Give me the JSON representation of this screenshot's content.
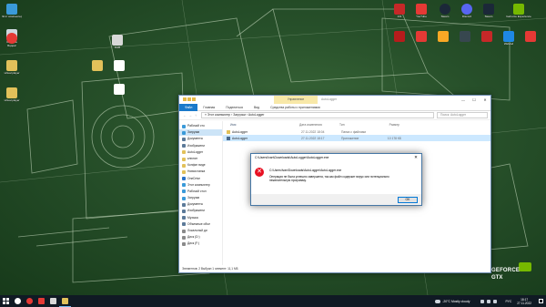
{
  "desktop": {
    "left_icons": [
      {
        "label": "Этот компьютер",
        "color": "#3a9ad9"
      },
      {
        "label": "Корзина",
        "color": "#cfd8e0"
      },
      {
        "label": "Яндекс",
        "color": "#e53935"
      },
      {
        "label": "virtual player",
        "color": "#e2c15a"
      },
      {
        "label": "virtual player",
        "color": "#e2c15a"
      }
    ],
    "mid_icons": [
      {
        "label": "DAB",
        "color": "#d8d8d8"
      },
      {
        "label": "",
        "color": "#e2c15a"
      },
      {
        "label": "",
        "color": "#ffffff"
      },
      {
        "label": "",
        "color": "#ffffff"
      }
    ],
    "top_icons_row1": [
      {
        "label": "131",
        "color": "#c62828"
      },
      {
        "label": "YouTube",
        "color": "#e53935"
      },
      {
        "label": "Steam",
        "color": "#1b2838"
      },
      {
        "label": "Discord",
        "color": "#5865f2"
      },
      {
        "label": "Steam",
        "color": "#1b2838"
      },
      {
        "label": "GeForce Experience",
        "color": "#76b900"
      }
    ],
    "top_icons_row2": [
      {
        "label": "",
        "color": "#b71c1c"
      },
      {
        "label": "",
        "color": "#e53935"
      },
      {
        "label": "",
        "color": "#f9a825"
      },
      {
        "label": "",
        "color": "#37474f"
      },
      {
        "label": "",
        "color": "#c62828"
      },
      {
        "label": "WeMod",
        "color": "#1e88e5"
      },
      {
        "label": "",
        "color": "#e53935"
      }
    ],
    "brand": {
      "line1": "GEFORCE",
      "line2": "GTX",
      "color": "#76b900"
    }
  },
  "explorer": {
    "ribbon_context": "Управление",
    "title": "AutoLogger",
    "tabs": [
      "Файл",
      "Главная",
      "Поделиться",
      "Вид",
      "Средства работы с приложениями"
    ],
    "breadcrumb": "« Этот компьютер › Загрузки › AutoLogger",
    "search_placeholder": "Поиск: AutoLogger",
    "nav_items": [
      {
        "label": "Рабочий сто",
        "color": "#3a9ad9"
      },
      {
        "label": "Загрузки",
        "color": "#3a9ad9"
      },
      {
        "label": "Документы",
        "color": "#5c7a99"
      },
      {
        "label": "Изображени",
        "color": "#5c7a99"
      },
      {
        "label": "AutoLogger",
        "color": "#e2c15a"
      },
      {
        "label": "клюнит",
        "color": "#e2c15a"
      },
      {
        "label": "Конфиг виде",
        "color": "#e2c15a"
      },
      {
        "label": "Новая папка",
        "color": "#e2c15a"
      },
      {
        "label": "OneDrive",
        "color": "#2a72c9"
      },
      {
        "label": "Этот компьютер",
        "color": "#3a9ad9"
      },
      {
        "label": "Рабочий стол",
        "color": "#3a9ad9"
      },
      {
        "label": "Загрузки",
        "color": "#3a9ad9"
      },
      {
        "label": "Документы",
        "color": "#5c7a99"
      },
      {
        "label": "Изображени",
        "color": "#5c7a99"
      },
      {
        "label": "Музыка",
        "color": "#5c7a99"
      },
      {
        "label": "Объемные объе",
        "color": "#5c7a99"
      },
      {
        "label": "Локальный ди",
        "color": "#8a8a8a"
      },
      {
        "label": "Диск (D:)",
        "color": "#8a8a8a"
      },
      {
        "label": "Диск (F:)",
        "color": "#8a8a8a"
      }
    ],
    "columns": {
      "name": "Имя",
      "date": "Дата изменения",
      "type": "Тип",
      "size": "Размер"
    },
    "files": [
      {
        "name": "AutoLogger",
        "date": "27.11.2022 18:04",
        "type": "Папка с файлами",
        "size": "",
        "color": "#e2c15a"
      },
      {
        "name": "AutoLogger",
        "date": "27.11.2022 18:17",
        "type": "Приложение",
        "size": "10 178 КБ",
        "color": "#4a6a8c"
      }
    ],
    "status": "Элементов: 2    Выбран 1 элемент: 11,1 МБ"
  },
  "dialog": {
    "title": "C:\\Users\\Ivan\\Downloads\\AutoLogger\\AutoLogger.exe",
    "path": "C:\\Users\\Ivan\\Downloads\\AutoLogger\\AutoLogger.exe",
    "message": "Операция не была успешно завершена, так как файл содержит вирус или потенциально нежелательную программу.",
    "ok_label": "OK"
  },
  "taskbar": {
    "apps": [
      {
        "name": "search",
        "color": "#ffffff"
      },
      {
        "name": "yandex",
        "color": "#e53935"
      },
      {
        "name": "media",
        "color": "#e53935"
      },
      {
        "name": "notepad",
        "color": "#d8d8d8"
      },
      {
        "name": "explorer",
        "color": "#e2c15a"
      }
    ],
    "weather": "-20°C Mostly cloudy",
    "lang": "РУС",
    "time": "18:17",
    "date": "27.11.2022"
  }
}
